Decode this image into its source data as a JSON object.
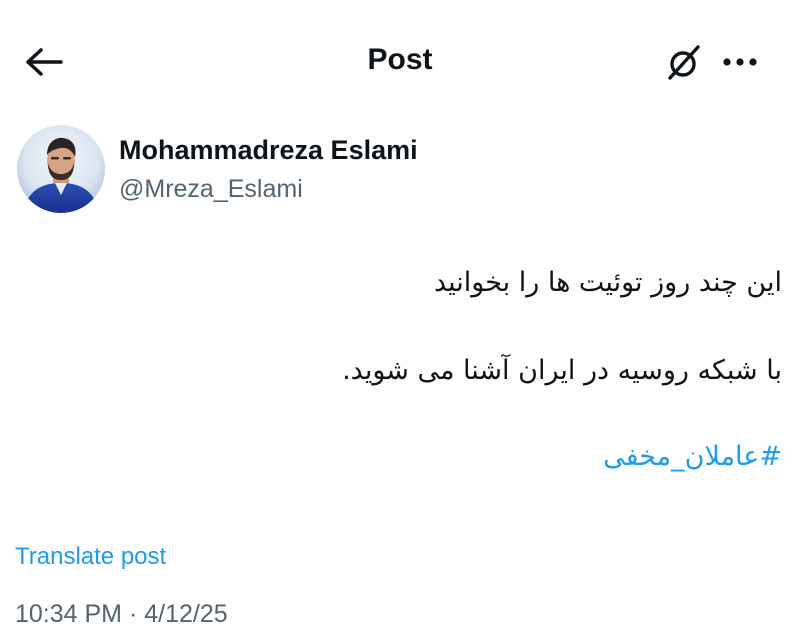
{
  "header": {
    "title": "Post",
    "back_icon": "arrow-left-icon",
    "grok_icon": "grok-icon",
    "more_icon": "more-horizontal-icon"
  },
  "author": {
    "display_name": "Mohammadreza Eslami",
    "handle": "@Mreza_Eslami",
    "avatar_icon": "user-avatar"
  },
  "tweet": {
    "lines": [
      "این چند روز توئیت ها را بخوانید",
      "با شبکه روسیه در ایران آشنا می شوید.",
      "#عاملان_مخفی"
    ],
    "translate_label": "Translate post",
    "timestamp": "10:34 PM · 4/12/25"
  },
  "colors": {
    "text": "#0f1419",
    "secondary": "#536471",
    "link": "#1d9bf0",
    "background": "#ffffff"
  }
}
